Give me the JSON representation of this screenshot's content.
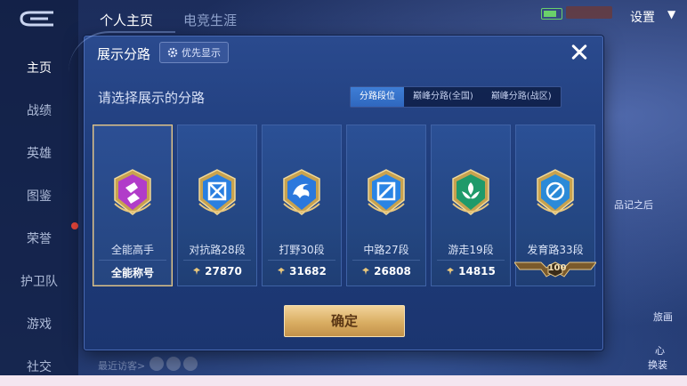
{
  "background": {
    "top_tabs": [
      "个人主页",
      "电竞生涯"
    ],
    "settings": "设置",
    "nav": [
      "主页",
      "战绩",
      "英雄",
      "图鉴",
      "荣誉",
      "护卫队",
      "游戏",
      "社交"
    ],
    "recent_label": "最近访客>",
    "right_labels": [
      "品记之后",
      "旅画",
      "心",
      "换装"
    ]
  },
  "modal": {
    "title": "展示分路",
    "priority_label": "优先显示",
    "select_title": "请选择展示的分路",
    "tabs": [
      "分路段位",
      "巅峰分路(全国)",
      "巅峰分路(战区)"
    ],
    "active_tab": 0,
    "cards": [
      {
        "name": "全能高手",
        "footer": "全能称号",
        "score": null,
        "emblem_color": "#b13cc9",
        "selected": true
      },
      {
        "name": "对抗路28段",
        "footer": null,
        "score": "27870",
        "emblem_color": "#2a7fe0",
        "selected": false
      },
      {
        "name": "打野30段",
        "footer": null,
        "score": "31682",
        "emblem_color": "#2b78dd",
        "selected": false
      },
      {
        "name": "中路27段",
        "footer": null,
        "score": "26808",
        "emblem_color": "#2a84e4",
        "selected": false
      },
      {
        "name": "游走19段",
        "footer": null,
        "score": "14815",
        "emblem_color": "#1f9a6a",
        "selected": false
      },
      {
        "name": "发育路33段",
        "footer": null,
        "score": null,
        "badge": "100",
        "emblem_color": "#2b8ad8",
        "selected": false
      }
    ],
    "confirm_label": "确定"
  },
  "colors": {
    "accent_gold": "#d9ad62",
    "selected_border": "#e8c988",
    "active_tab": "#3e7ed6"
  }
}
